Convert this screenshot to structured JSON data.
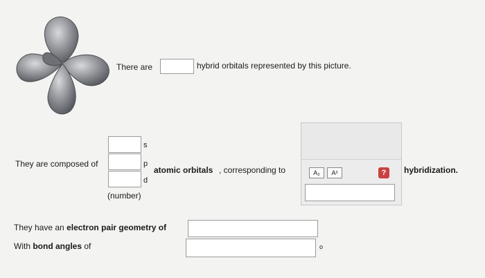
{
  "q1": {
    "prefix": "There are",
    "suffix": "hybrid orbitals represented by this picture."
  },
  "q2": {
    "prefix": "They are composed of",
    "label_s": "s",
    "label_p": "p",
    "label_d": "d",
    "number_note": "(number)",
    "atomic_orbitals": "atomic orbitals",
    "corresponding": ", corresponding to",
    "hybridization": "hybridization."
  },
  "formatting": {
    "subscript_label": "A₂",
    "superscript_label": "A²",
    "help_icon": "?"
  },
  "q3": {
    "prefix_normal": "They have an",
    "prefix_bold": "electron pair geometry",
    "prefix_end": "of"
  },
  "q4": {
    "prefix_normal": "With",
    "prefix_bold": "bond angles",
    "prefix_end": "of",
    "unit": "o"
  },
  "colors": {
    "orbital_gray": "#8a8c90",
    "help_red": "#c9413f"
  }
}
